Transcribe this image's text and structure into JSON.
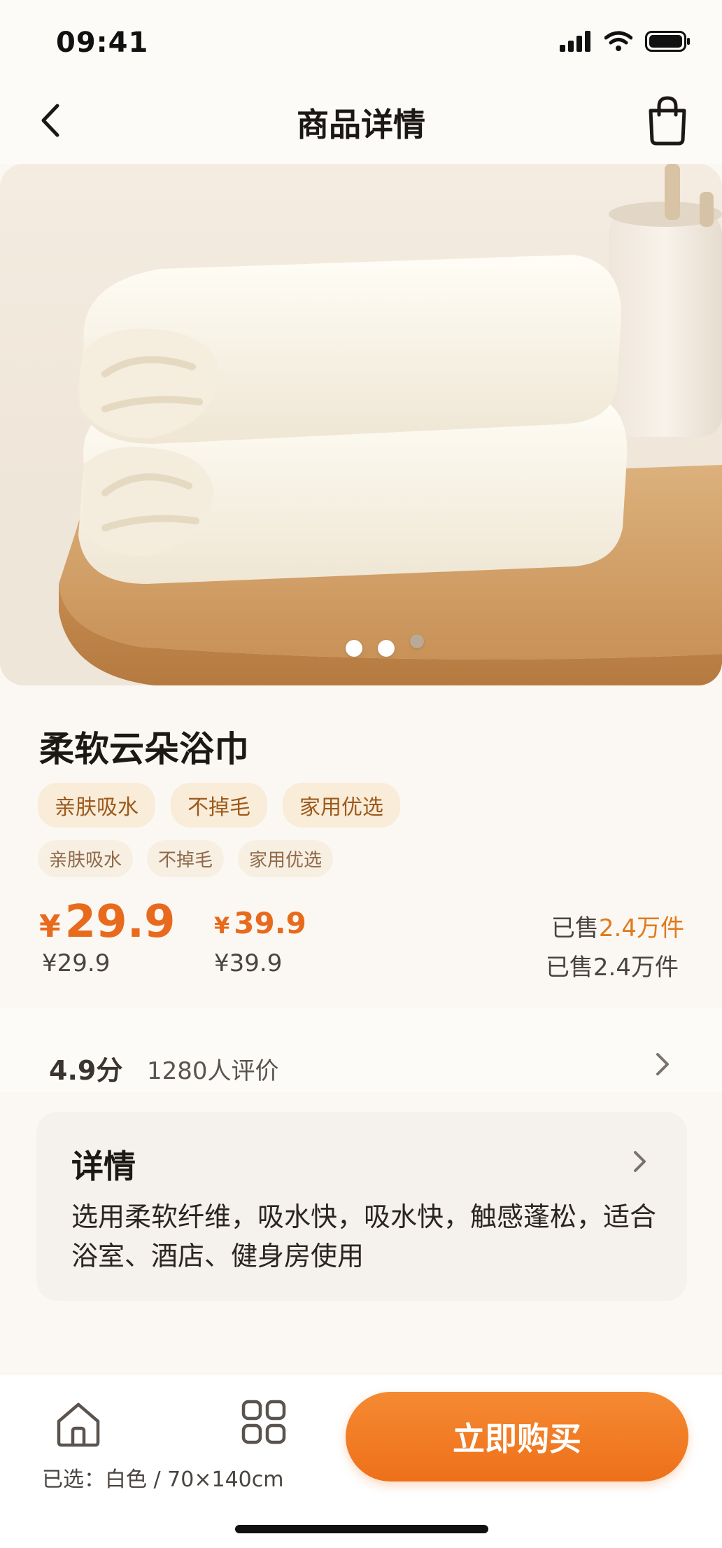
{
  "status_bar": {
    "time": "09:41"
  },
  "nav": {
    "title": "商品详情"
  },
  "hero": {
    "image": "folded-white-towels-on-wooden-board",
    "dots": 3,
    "active_dot": 2
  },
  "product": {
    "title": "柔软云朵浴巾",
    "tags": [
      "亲肤吸水",
      "不掉毛",
      "家用优选"
    ],
    "tags_small": [
      "亲肤吸水",
      "不掉毛",
      "家用优选"
    ],
    "price": {
      "symbol": "¥",
      "value": "29.9",
      "plain": "¥29.9"
    },
    "original_price": {
      "symbol": "¥",
      "value": "39.9",
      "plain": "¥39.9"
    },
    "sold": {
      "prefix": "已售",
      "highlight": "2.4万件",
      "plain": "已售2.4万件"
    }
  },
  "rating": {
    "score": "4.9分",
    "count": "1280人评价"
  },
  "detail": {
    "title": "详情",
    "text": "选用柔软纤维，吸水快，吸水快，触感蓬松，适合浴室、酒店、健身房使用"
  },
  "bottom": {
    "selected": "已选：白色 / 70×140cm",
    "buy_label": "立即购买"
  },
  "colors": {
    "accent": "#ee7019",
    "tag_bg": "#f9ecd9",
    "tag_text": "#9c5a1c",
    "background": "#fbf8f3"
  },
  "icons": [
    "back-icon",
    "shopping-bag-icon",
    "signal-icon",
    "wifi-icon",
    "battery-icon",
    "chevron-right-icon",
    "home-icon",
    "grid-icon"
  ]
}
